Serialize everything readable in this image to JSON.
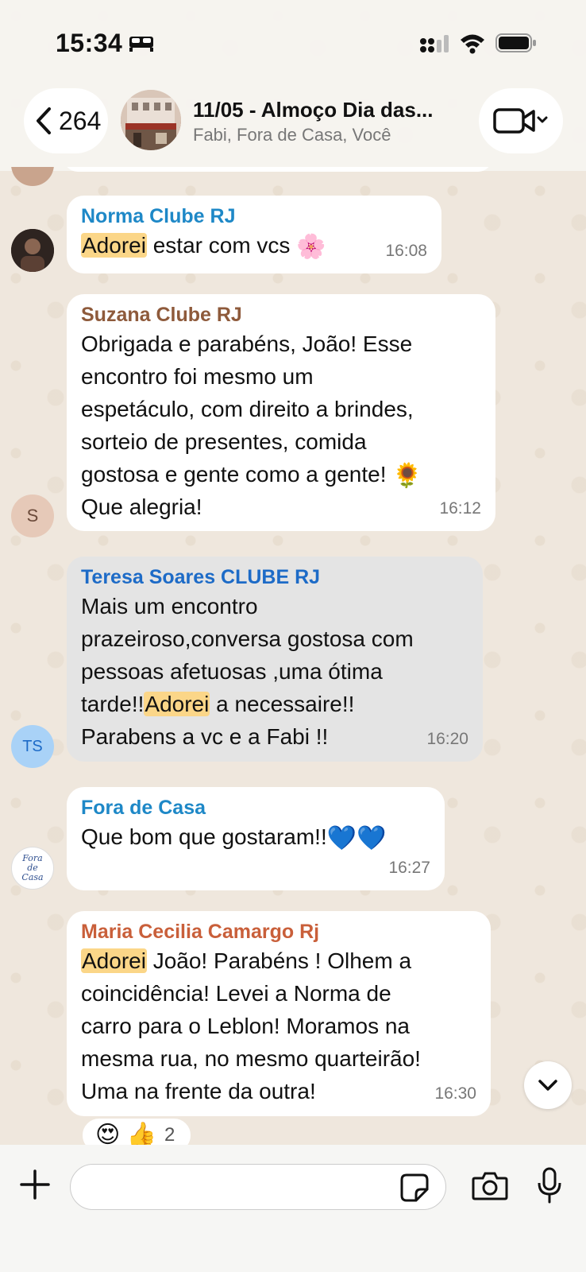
{
  "status_bar": {
    "time": "15:34"
  },
  "header": {
    "back_count": "264",
    "title": "11/05 - Almoço Dia das...",
    "subtitle": "Fabi, Fora de Casa, Você"
  },
  "messages": [
    {
      "sender": "Norma Clube RJ",
      "sender_color": "#1e88c7",
      "highlight": "Adorei",
      "text": " estar com vcs ",
      "emoji": "🌸",
      "time": "16:08"
    },
    {
      "sender": "Suzana Clube RJ",
      "sender_color": "#8e5a3b",
      "avatar_initial": "S",
      "lines": [
        "Obrigada  e parabéns, João! Esse",
        "encontro foi mesmo um",
        "espetáculo, com direito a brindes,",
        "sorteio de presentes, comida",
        "gostosa  e gente como a gente! ",
        "Que alegria!"
      ],
      "emoji": "🌻",
      "time": "16:12"
    },
    {
      "sender": "Teresa Soares CLUBE RJ",
      "sender_color": "#1d6bc7",
      "avatar_initial": "TS",
      "lines": [
        "Mais um encontro",
        "prazeiroso,conversa gostosa com",
        "pessoas afetuosas ,uma ótima",
        "tarde!!",
        " a necessaire!!",
        "Parabens a vc e a Fabi !!"
      ],
      "highlight": "Adorei",
      "time": "16:20"
    },
    {
      "sender": "Fora de Casa",
      "sender_color": "#1e88c7",
      "avatar_text": "Fora de Casa",
      "text": "Que bom que gostaram!!",
      "emoji": "💙💙",
      "time": "16:27"
    },
    {
      "sender": "Maria Cecilia Camargo Rj",
      "sender_color": "#c95f3a",
      "highlight": "Adorei",
      "lines": [
        " João! Parabéns ! Olhem a",
        "coincidência! Levei a Norma de",
        "carro para o Leblon! Moramos na",
        "mesma rua, no mesmo quarteirão!",
        "Uma na frente da outra!"
      ],
      "time": "16:30",
      "reactions": {
        "emojis": "😍 👍",
        "count": "2"
      }
    }
  ],
  "composer": {
    "value": ""
  }
}
